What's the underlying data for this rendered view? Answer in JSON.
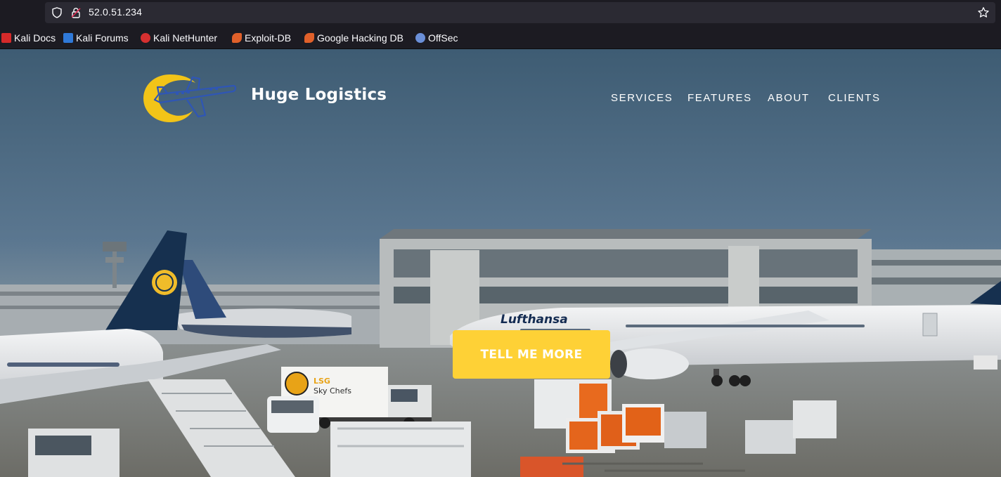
{
  "browser": {
    "url": "52.0.51.234",
    "bookmarks": [
      {
        "label": "Kali Docs",
        "icon": "kali-docs-icon",
        "color": "#d62a2a"
      },
      {
        "label": "Kali Forums",
        "icon": "kali-forums-icon",
        "color": "#2f79d8"
      },
      {
        "label": "Kali NetHunter",
        "icon": "kali-nethunter-icon",
        "color": "#d63030"
      },
      {
        "label": "Exploit-DB",
        "icon": "exploit-db-icon",
        "color": "#e0602a"
      },
      {
        "label": "Google Hacking DB",
        "icon": "ghdb-icon",
        "color": "#e0602a"
      },
      {
        "label": "OffSec",
        "icon": "offsec-icon",
        "color": "#6a8fd8"
      }
    ]
  },
  "site": {
    "brand": "Huge Logistics",
    "nav": [
      "SERVICES",
      "FEATURES",
      "ABOUT",
      "CLIENTS"
    ],
    "cta_label": "TELL ME MORE",
    "accent_color": "#fed136"
  }
}
